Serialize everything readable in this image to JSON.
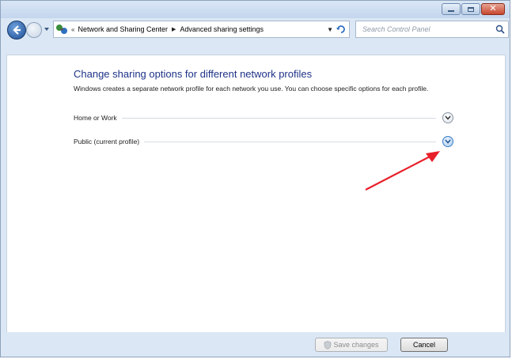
{
  "address_bar": {
    "overflow": "«",
    "segments": [
      "Network and Sharing Center",
      "Advanced sharing settings"
    ]
  },
  "search": {
    "placeholder": "Search Control Panel"
  },
  "main": {
    "heading": "Change sharing options for different network profiles",
    "description": "Windows creates a separate network profile for each network you use. You can choose specific options for each profile.",
    "profiles": [
      {
        "label": "Home or Work",
        "expanded": false
      },
      {
        "label": "Public (current profile)",
        "expanded": false
      }
    ]
  },
  "footer": {
    "save_label": "Save changes",
    "save_disabled": true,
    "cancel_label": "Cancel"
  },
  "colors": {
    "heading": "#1e3287",
    "window_frame": "#dbe7f4",
    "annotation_arrow": "#e8202a"
  },
  "icons": {
    "back": "back-arrow-icon",
    "forward": "forward-arrow-icon",
    "location": "network-icon",
    "refresh": "refresh-icon",
    "search": "magnifier-icon",
    "expand": "chevron-down-icon",
    "save": "uac-shield-icon"
  }
}
